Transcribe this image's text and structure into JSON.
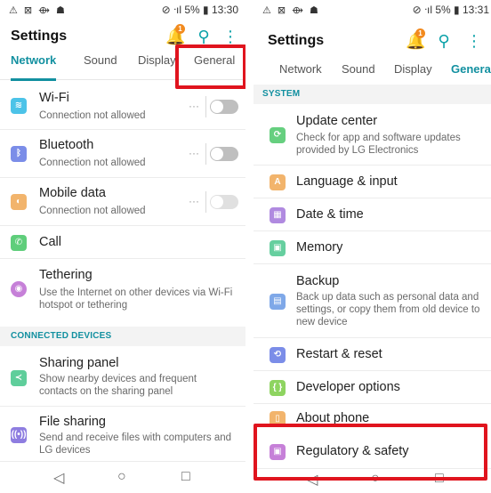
{
  "left": {
    "status": {
      "left_icons": "⚠ ⊠ ⟴ ☗",
      "right": "⊘ ᐧıl 5% ▮ 13:30"
    },
    "title": "Settings",
    "notification_badge": "1",
    "tabs": [
      "Network",
      "Sound",
      "Display",
      "General"
    ],
    "active_tab": "Network",
    "rows": [
      {
        "title": "Wi-Fi",
        "subtitle": "Connection not allowed",
        "icon": "wifi-icon",
        "color": "#4cc3e8"
      },
      {
        "title": "Bluetooth",
        "subtitle": "Connection not allowed",
        "icon": "bluetooth-icon",
        "color": "#7b8de8"
      },
      {
        "title": "Mobile data",
        "subtitle": "Connection not allowed",
        "icon": "mobile-data-icon",
        "color": "#f2b46c"
      },
      {
        "title": "Call",
        "subtitle": "",
        "icon": "call-icon",
        "color": "#5fce7b"
      },
      {
        "title": "Tethering",
        "subtitle": "Use the Internet on other devices via Wi-Fi hotspot or tethering",
        "icon": "tethering-icon",
        "color": "#c680d8"
      }
    ],
    "section_connected": "CONNECTED DEVICES",
    "rows2": [
      {
        "title": "Sharing panel",
        "subtitle": "Show nearby devices and frequent contacts on the sharing panel",
        "icon": "share-icon",
        "color": "#5fce9b"
      },
      {
        "title": "File sharing",
        "subtitle": "Send and receive files with computers and LG devices",
        "icon": "file-sharing-icon",
        "color": "#8e7de0"
      }
    ],
    "overflow_dots": "···"
  },
  "right": {
    "status": {
      "left_icons": "⚠ ⊠ ⟴ ☗",
      "right": "⊘ ᐧıl 5% ▮ 13:31"
    },
    "title": "Settings",
    "notification_badge": "1",
    "tabs": [
      "Network",
      "Sound",
      "Display",
      "General"
    ],
    "active_tab": "General",
    "section_system": "SYSTEM",
    "rows": [
      {
        "title": "Update center",
        "subtitle": "Check for app and software updates provided by LG Electronics",
        "icon": "update-icon",
        "color": "#66cf7f"
      },
      {
        "title": "Language & input",
        "subtitle": "",
        "icon": "language-icon",
        "color": "#f2b46c"
      },
      {
        "title": "Date & time",
        "subtitle": "",
        "icon": "date-time-icon",
        "color": "#b08ae0"
      },
      {
        "title": "Memory",
        "subtitle": "",
        "icon": "memory-icon",
        "color": "#66cf9f"
      },
      {
        "title": "Backup",
        "subtitle": "Back up data such as personal data and settings, or copy them from old device to new device",
        "icon": "backup-icon",
        "color": "#7fa8e8"
      },
      {
        "title": "Restart & reset",
        "subtitle": "",
        "icon": "restart-icon",
        "color": "#7b8de8"
      },
      {
        "title": "Developer options",
        "subtitle": "",
        "icon": "developer-icon",
        "color": "#8ed460"
      },
      {
        "title": "About phone",
        "subtitle": "",
        "icon": "about-icon",
        "color": "#f2b46c"
      },
      {
        "title": "Regulatory & safety",
        "subtitle": "",
        "icon": "regulatory-icon",
        "color": "#c680d8"
      }
    ]
  },
  "nav": {
    "back": "◁",
    "home": "○",
    "recents": "□"
  },
  "accent_color": "#1290a0",
  "highlight_color": "#e0141e"
}
